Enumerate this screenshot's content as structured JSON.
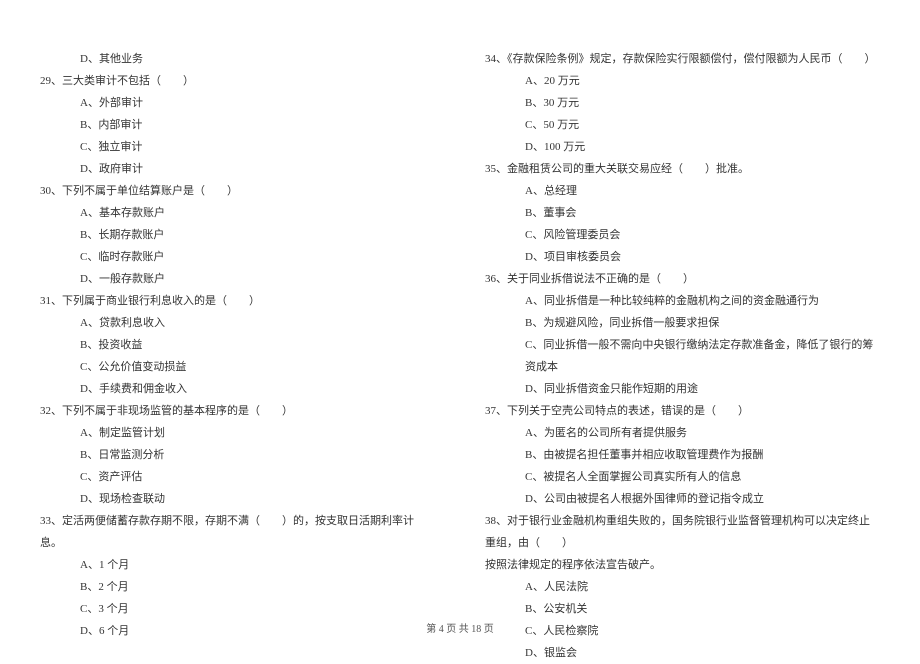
{
  "left": {
    "pre": [
      {
        "label": "D、",
        "text": "其他业务"
      }
    ],
    "questions": [
      {
        "num": "29、",
        "text": "三大类审计不包括（　　）",
        "opts": [
          [
            "A、",
            "外部审计"
          ],
          [
            "B、",
            "内部审计"
          ],
          [
            "C、",
            "独立审计"
          ],
          [
            "D、",
            "政府审计"
          ]
        ]
      },
      {
        "num": "30、",
        "text": "下列不属于单位结算账户是（　　）",
        "opts": [
          [
            "A、",
            "基本存款账户"
          ],
          [
            "B、",
            "长期存款账户"
          ],
          [
            "C、",
            "临时存款账户"
          ],
          [
            "D、",
            "一般存款账户"
          ]
        ]
      },
      {
        "num": "31、",
        "text": "下列属于商业银行利息收入的是（　　）",
        "opts": [
          [
            "A、",
            "贷款利息收入"
          ],
          [
            "B、",
            "投资收益"
          ],
          [
            "C、",
            "公允价值变动损益"
          ],
          [
            "D、",
            "手续费和佣金收入"
          ]
        ]
      },
      {
        "num": "32、",
        "text": "下列不属于非现场监管的基本程序的是（　　）",
        "opts": [
          [
            "A、",
            "制定监管计划"
          ],
          [
            "B、",
            "日常监测分析"
          ],
          [
            "C、",
            "资产评估"
          ],
          [
            "D、",
            "现场检查联动"
          ]
        ]
      },
      {
        "num": "33、",
        "text": "定活两便储蓄存款存期不限，存期不满（　　）的，按支取日活期利率计息。",
        "opts": [
          [
            "A、",
            "1 个月"
          ],
          [
            "B、",
            "2 个月"
          ],
          [
            "C、",
            "3 个月"
          ],
          [
            "D、",
            "6 个月"
          ]
        ]
      }
    ]
  },
  "right": {
    "questions": [
      {
        "num": "34、",
        "text": "《存款保险条例》规定，存款保险实行限额偿付，偿付限额为人民币（　　）",
        "opts": [
          [
            "A、",
            "20 万元"
          ],
          [
            "B、",
            "30 万元"
          ],
          [
            "C、",
            "50 万元"
          ],
          [
            "D、",
            "100 万元"
          ]
        ]
      },
      {
        "num": "35、",
        "text": "金融租赁公司的重大关联交易应经（　　）批准。",
        "opts": [
          [
            "A、",
            "总经理"
          ],
          [
            "B、",
            "董事会"
          ],
          [
            "C、",
            "风险管理委员会"
          ],
          [
            "D、",
            "项目审核委员会"
          ]
        ]
      },
      {
        "num": "36、",
        "text": "关于同业拆借说法不正确的是（　　）",
        "opts": [
          [
            "A、",
            "同业拆借是一种比较纯粹的金融机构之间的资金融通行为"
          ],
          [
            "B、",
            "为规避风险，同业拆借一般要求担保"
          ],
          [
            "C、",
            "同业拆借一般不需向中央银行缴纳法定存款准备金，降低了银行的筹资成本"
          ],
          [
            "D、",
            "同业拆借资金只能作短期的用途"
          ]
        ]
      },
      {
        "num": "37、",
        "text": "下列关于空壳公司特点的表述，错误的是（　　）",
        "opts": [
          [
            "A、",
            "为匿名的公司所有者提供服务"
          ],
          [
            "B、",
            "由被提名担任董事并相应收取管理费作为报酬"
          ],
          [
            "C、",
            "被提名人全面掌握公司真实所有人的信息"
          ],
          [
            "D、",
            "公司由被提名人根据外国律师的登记指令成立"
          ]
        ]
      },
      {
        "num": "38、",
        "text": "对于银行业金融机构重组失败的，国务院银行业监督管理机构可以决定终止重组，由（　　）",
        "tail": "按照法律规定的程序依法宣告破产。",
        "opts": [
          [
            "A、",
            "人民法院"
          ],
          [
            "B、",
            "公安机关"
          ],
          [
            "C、",
            "人民检察院"
          ],
          [
            "D、",
            "银监会"
          ]
        ]
      }
    ]
  },
  "footer": "第 4 页 共 18 页"
}
